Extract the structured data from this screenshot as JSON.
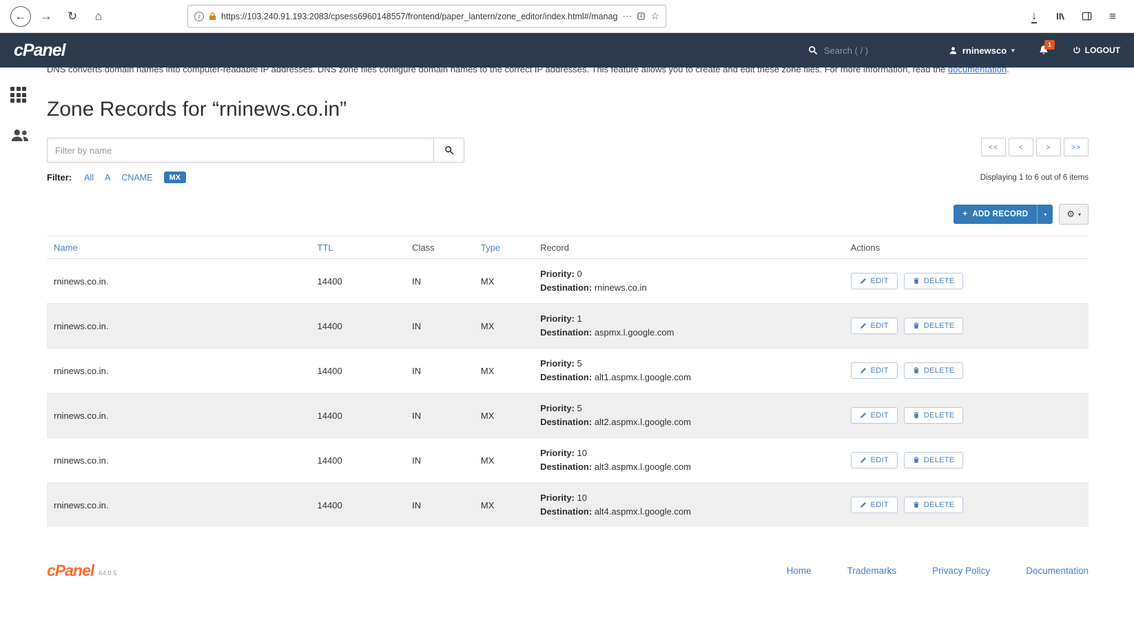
{
  "colors": {
    "header_bg": "#2b3a4c",
    "primary_blue": "#337ab7",
    "link_blue": "#4a7ebb",
    "notification_orange": "#e4571f",
    "cpanel_orange": "#ff6c2c"
  },
  "browser": {
    "url": "https://103.240.91.193:2083/cpsess6960148557/frontend/paper_lantern/zone_editor/index.html#/manag",
    "icons": {
      "back": "←",
      "forward": "→",
      "refresh": "↻",
      "home": "⌂",
      "more": "⋯",
      "star": "☆",
      "download": "↓",
      "menu": "≡"
    }
  },
  "header": {
    "logo": "cPanel",
    "search_label": "Search ( / )",
    "username": "rninewsco",
    "caret": "▾",
    "notification_count": "1",
    "logout_label": "LOGOUT"
  },
  "intro": {
    "text": "DNS converts domain names into computer-readable IP addresses. DNS zone files configure domain names to the correct IP addresses. This feature allows you to create and edit these zone files. For more information, read the ",
    "link": "documentation",
    "suffix": "."
  },
  "page": {
    "title": "Zone Records for “rninews.co.in”",
    "filter_placeholder": "Filter by name",
    "filter_label": "Filter:",
    "filters": [
      "All",
      "A",
      "CNAME",
      "MX"
    ],
    "pagination": [
      "<<",
      "<",
      ">",
      ">>"
    ],
    "displaying": "Displaying 1 to 6 out of 6 items",
    "add_record_plus": "+",
    "add_record_label": "ADD RECORD",
    "caret": "▾",
    "gear": "⚙"
  },
  "table": {
    "headers": [
      "Name",
      "TTL",
      "Class",
      "Type",
      "Record",
      "Actions"
    ],
    "priority_label": "Priority:",
    "destination_label": "Destination:",
    "edit_label": "EDIT",
    "delete_label": "DELETE",
    "rows": [
      {
        "name": "rninews.co.in.",
        "ttl": "14400",
        "class": "IN",
        "type": "MX",
        "priority": "0",
        "destination": "rninews.co.in"
      },
      {
        "name": "rninews.co.in.",
        "ttl": "14400",
        "class": "IN",
        "type": "MX",
        "priority": "1",
        "destination": "aspmx.l.google.com"
      },
      {
        "name": "rninews.co.in.",
        "ttl": "14400",
        "class": "IN",
        "type": "MX",
        "priority": "5",
        "destination": "alt1.aspmx.l.google.com"
      },
      {
        "name": "rninews.co.in.",
        "ttl": "14400",
        "class": "IN",
        "type": "MX",
        "priority": "5",
        "destination": "alt2.aspmx.l.google.com"
      },
      {
        "name": "rninews.co.in.",
        "ttl": "14400",
        "class": "IN",
        "type": "MX",
        "priority": "10",
        "destination": "alt3.aspmx.l.google.com"
      },
      {
        "name": "rninews.co.in.",
        "ttl": "14400",
        "class": "IN",
        "type": "MX",
        "priority": "10",
        "destination": "alt4.aspmx.l.google.com"
      }
    ]
  },
  "footer": {
    "logo": "cPanel",
    "version": "64.0.5",
    "links": [
      "Home",
      "Trademarks",
      "Privacy Policy",
      "Documentation"
    ]
  }
}
